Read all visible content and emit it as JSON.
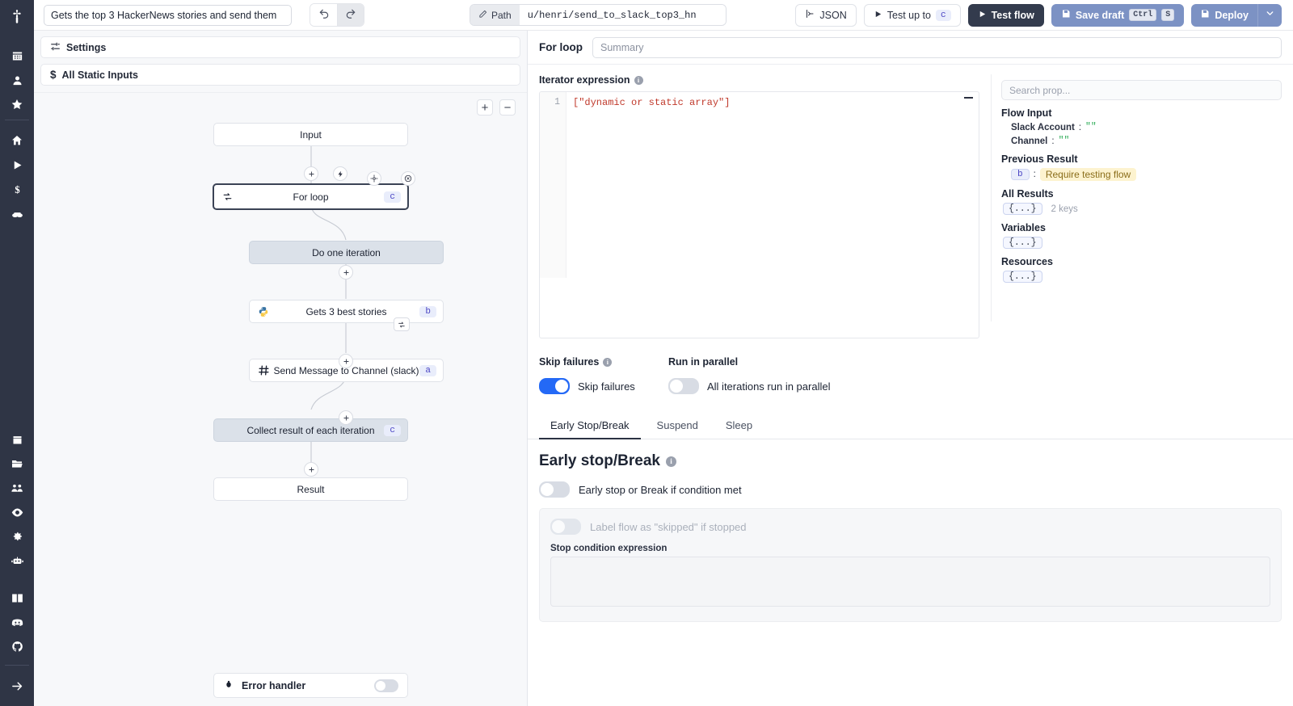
{
  "topbar": {
    "flow_title": "Gets the top 3 HackerNews stories and send them",
    "undo_icon": "undo-icon",
    "redo_icon": "redo-icon",
    "path_label": "Path",
    "path_value": "u/henri/send_to_slack_top3_hn",
    "json_label": "JSON",
    "test_up_to_label": "Test up to",
    "test_up_to_badge": "c",
    "test_flow_label": "Test flow",
    "save_draft_label": "Save draft",
    "save_draft_kbd1": "Ctrl",
    "save_draft_kbd2": "S",
    "deploy_label": "Deploy"
  },
  "rail": {
    "logo": "windmill-logo",
    "items": [
      {
        "name": "apps-icon"
      },
      {
        "name": "user-icon"
      },
      {
        "name": "star-icon"
      },
      {
        "name": "home-icon"
      },
      {
        "name": "runs-play-icon"
      },
      {
        "name": "variables-dollar-icon"
      },
      {
        "name": "resources-icon"
      },
      {
        "name": "schedules-calendar-icon"
      },
      {
        "name": "folders-icon"
      },
      {
        "name": "groups-icon"
      },
      {
        "name": "audit-eye-icon"
      },
      {
        "name": "settings-gear-icon"
      },
      {
        "name": "workers-robot-icon"
      },
      {
        "name": "docs-book-icon"
      },
      {
        "name": "discord-icon"
      },
      {
        "name": "github-icon"
      },
      {
        "name": "expand-arrow-icon"
      }
    ]
  },
  "graph_panel": {
    "settings_label": "Settings",
    "static_inputs_label": "All Static Inputs",
    "zoom_in": "+",
    "zoom_out": "−",
    "error_handler_label": "Error handler",
    "error_handler_enabled": false,
    "nodes": [
      {
        "id": "input",
        "label": "Input",
        "style": "plain",
        "badge": "",
        "icon": ""
      },
      {
        "id": "forloop",
        "label": "For loop",
        "style": "sel",
        "badge": "c",
        "icon": "loop-icon"
      },
      {
        "id": "doiter",
        "label": "Do one iteration",
        "style": "grey",
        "badge": "",
        "icon": ""
      },
      {
        "id": "python",
        "label": "Gets 3 best stories",
        "style": "plain",
        "badge": "b",
        "icon": "python-icon"
      },
      {
        "id": "slack",
        "label": "Send Message to Channel (slack)",
        "style": "plain",
        "badge": "a",
        "icon": "slack-icon"
      },
      {
        "id": "collect",
        "label": "Collect result of each iteration",
        "style": "grey",
        "badge": "c",
        "icon": ""
      },
      {
        "id": "result",
        "label": "Result",
        "style": "plain",
        "badge": "",
        "icon": ""
      }
    ]
  },
  "right": {
    "title": "For loop",
    "summary_placeholder": "Summary",
    "summary_value": "",
    "iterator_label": "Iterator expression",
    "code_line_number": "1",
    "code_text": "[\"dynamic or static array\"]",
    "props": {
      "search_placeholder": "Search prop...",
      "flow_input_head": "Flow Input",
      "flow_input": [
        {
          "key": "Slack Account",
          "value": "\"\""
        },
        {
          "key": "Channel",
          "value": "\"\""
        }
      ],
      "previous_result_head": "Previous Result",
      "previous_result_badge": "b",
      "previous_result_value": "Require testing flow",
      "all_results_head": "All Results",
      "all_results_obj": "{...}",
      "all_results_keys": "2 keys",
      "variables_head": "Variables",
      "variables_obj": "{...}",
      "resources_head": "Resources",
      "resources_obj": "{...}"
    },
    "skip_failures_head": "Skip failures",
    "skip_failures_label": "Skip failures",
    "skip_failures_on": true,
    "run_parallel_head": "Run in parallel",
    "run_parallel_label": "All iterations run in parallel",
    "run_parallel_on": false,
    "tabs": [
      {
        "label": "Early Stop/Break",
        "active": true
      },
      {
        "label": "Suspend",
        "active": false
      },
      {
        "label": "Sleep",
        "active": false
      }
    ],
    "early_stop_heading": "Early stop/Break",
    "early_stop_toggle_label": "Early stop or Break if condition met",
    "early_stop_on": false,
    "label_skipped_toggle_label": "Label flow as \"skipped\" if stopped",
    "label_skipped_on": false,
    "stop_condition_label": "Stop condition expression",
    "stop_condition_value": ""
  },
  "colors": {
    "accent_blue": "#2469f6",
    "deploy_blue": "#7c92c4",
    "dark": "#333b4d",
    "badge_bg": "#e9edfb",
    "badge_fg": "#4b45c4",
    "warn_bg": "#fdf3cf",
    "warn_fg": "#8a6d1a",
    "rail_bg": "#2f3545"
  }
}
